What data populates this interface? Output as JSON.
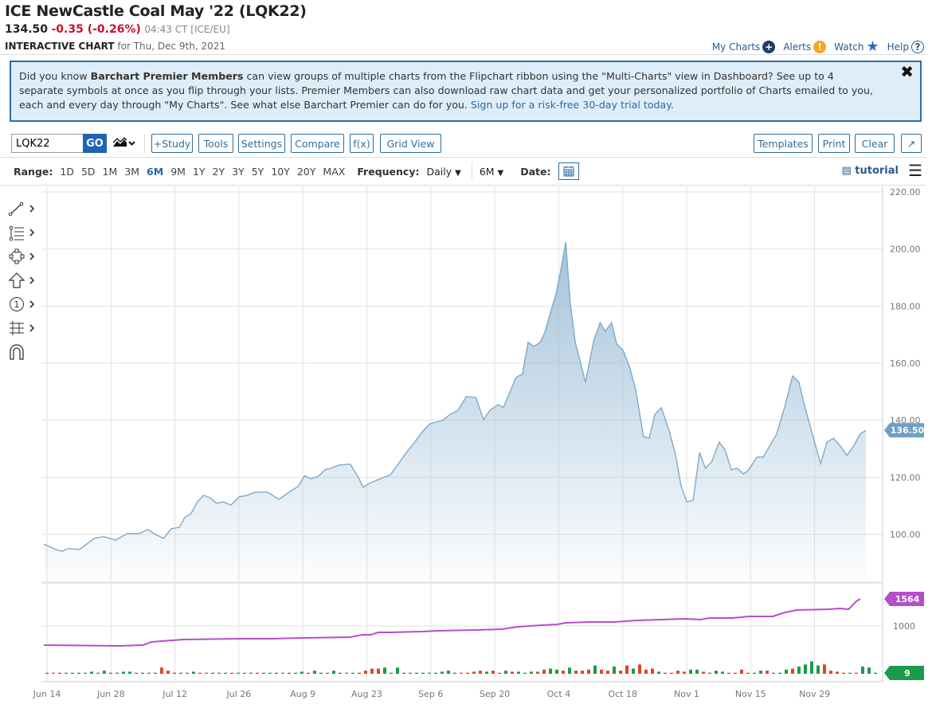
{
  "header": {
    "title": "ICE NewCastle Coal May '22 (LQK22)",
    "last": "134.50",
    "change": "-0.35 (-0.26%)",
    "time": "04:43 CT [ICE/EU]",
    "subtitle_bold": "INTERACTIVE CHART",
    "subtitle_rest": "for Thu, Dec 9th, 2021"
  },
  "top_links": {
    "my_charts": "My Charts",
    "alerts": "Alerts",
    "watch": "Watch",
    "help": "Help"
  },
  "info": {
    "t1": "Did you know ",
    "bold": "Barchart Premier Members",
    "t2": " can view groups of multiple charts from the Flipchart ribbon using the \"Multi-Charts\" view in Dashboard? See up to 4 separate symbols at once as you flip through your lists. Premier Members can also download raw chart data and get your personalized portfolio of Charts emailed to you, each and every day through \"My Charts\". See what else Barchart Premier can do for you. ",
    "link": "Sign up for a risk-free 30-day trial today",
    "t3": ".",
    "close": "✖"
  },
  "toolbar": {
    "symbol": "LQK22",
    "go": "GO",
    "study": "+Study",
    "tools": "Tools",
    "settings": "Settings",
    "compare": "Compare",
    "fx": "f(x)",
    "grid": "Grid View",
    "templates": "Templates",
    "print": "Print",
    "clear": "Clear"
  },
  "range": {
    "label": "Range:",
    "options": [
      "1D",
      "5D",
      "1M",
      "3M",
      "6M",
      "9M",
      "1Y",
      "2Y",
      "3Y",
      "5Y",
      "10Y",
      "20Y",
      "MAX"
    ],
    "selected": "6M",
    "frequency_label": "Frequency:",
    "frequency": "Daily",
    "period": "6M",
    "date_label": "Date:",
    "tutorial": "tutorial"
  },
  "colors": {
    "price_line": "#7fa9c9",
    "price_fill": "#9fc0d8",
    "oi_line": "#b54fc9",
    "up": "#1a9b4b",
    "down": "#e0452c",
    "tag_price": "#6ea0c4"
  },
  "chart_data": {
    "type": "area",
    "x_unit": "trading day index from Jun 14",
    "x_labels": [
      "Jun 14",
      "Jun 28",
      "Jul 12",
      "Jul 26",
      "Aug 9",
      "Aug 23",
      "Sep 6",
      "Sep 20",
      "Oct 4",
      "Oct 18",
      "Nov 1",
      "Nov 15",
      "Nov 29"
    ],
    "y_ticks": [
      "220.00",
      "200.00",
      "180.00",
      "160.00",
      "140.00",
      "120.00",
      "100.00"
    ],
    "ylim": [
      100,
      220
    ],
    "price": [
      [
        -0.5,
        96.6
      ],
      [
        1.4,
        94.7
      ],
      [
        2.4,
        94.1
      ],
      [
        3.3,
        95
      ],
      [
        5.1,
        94.7
      ],
      [
        6.1,
        96.4
      ],
      [
        7.4,
        98.6
      ],
      [
        8.9,
        99.2
      ],
      [
        10.8,
        98
      ],
      [
        12.6,
        100.3
      ],
      [
        14.5,
        100.3
      ],
      [
        15.8,
        101.7
      ],
      [
        17,
        100
      ],
      [
        18.3,
        98.6
      ],
      [
        19.5,
        102
      ],
      [
        20.8,
        102.5
      ],
      [
        21.6,
        105.9
      ],
      [
        22.6,
        107.3
      ],
      [
        23.6,
        111.4
      ],
      [
        24.6,
        113.7
      ],
      [
        25.6,
        112.8
      ],
      [
        26.6,
        110.9
      ],
      [
        27.6,
        111.4
      ],
      [
        28.9,
        110.3
      ],
      [
        30.1,
        113.1
      ],
      [
        31.4,
        113.7
      ],
      [
        32.6,
        114.8
      ],
      [
        34.6,
        114.8
      ],
      [
        36.4,
        112.3
      ],
      [
        37.6,
        114.2
      ],
      [
        39.5,
        117
      ],
      [
        40.4,
        120.6
      ],
      [
        41.4,
        119.5
      ],
      [
        42.6,
        120.4
      ],
      [
        43.6,
        122.6
      ],
      [
        44.5,
        123.2
      ],
      [
        45.8,
        124.3
      ],
      [
        47.6,
        124.6
      ],
      [
        48.9,
        119.8
      ],
      [
        49.6,
        116.5
      ],
      [
        50.8,
        118.1
      ],
      [
        52.6,
        119.8
      ],
      [
        53.9,
        120.9
      ],
      [
        55.1,
        124.6
      ],
      [
        56.4,
        128.7
      ],
      [
        57.6,
        132
      ],
      [
        58.9,
        136
      ],
      [
        60.1,
        138.8
      ],
      [
        62,
        139.9
      ],
      [
        63.3,
        142.1
      ],
      [
        64.5,
        143.5
      ],
      [
        65.8,
        148.3
      ],
      [
        67.3,
        148
      ],
      [
        68.5,
        140.2
      ],
      [
        69.5,
        143.5
      ],
      [
        70.8,
        145.5
      ],
      [
        71.6,
        144.4
      ],
      [
        72.6,
        149.7
      ],
      [
        73.6,
        155
      ],
      [
        74.6,
        156.2
      ],
      [
        75.5,
        167.3
      ],
      [
        76.4,
        165.9
      ],
      [
        77.4,
        167.3
      ],
      [
        78.1,
        170.7
      ],
      [
        79.1,
        178.4
      ],
      [
        79.9,
        184.5
      ],
      [
        80.6,
        192.3
      ],
      [
        81.4,
        202.4
      ],
      [
        82.1,
        181.2
      ],
      [
        82.9,
        167.3
      ],
      [
        83.6,
        161.2
      ],
      [
        84.5,
        153.3
      ],
      [
        85.8,
        167.9
      ],
      [
        86.8,
        174.2
      ],
      [
        87.6,
        171.2
      ],
      [
        88.6,
        174.2
      ],
      [
        89.4,
        166.7
      ],
      [
        90.4,
        164.5
      ],
      [
        91.4,
        158.9
      ],
      [
        92.4,
        150.5
      ],
      [
        93.6,
        134.3
      ],
      [
        94.5,
        133.7
      ],
      [
        95.4,
        142.1
      ],
      [
        96.4,
        144.4
      ],
      [
        97.6,
        136.6
      ],
      [
        98.6,
        128.2
      ],
      [
        99.5,
        117
      ],
      [
        100.4,
        111.4
      ],
      [
        101.4,
        112
      ],
      [
        102.4,
        128.7
      ],
      [
        103.3,
        123.2
      ],
      [
        104.3,
        125.4
      ],
      [
        105.5,
        132.4
      ],
      [
        106.4,
        129.6
      ],
      [
        107.4,
        122.6
      ],
      [
        108.3,
        123.2
      ],
      [
        109.3,
        121.2
      ],
      [
        110.1,
        122.6
      ],
      [
        111.4,
        127.1
      ],
      [
        112.4,
        127.1
      ],
      [
        113.4,
        131
      ],
      [
        114.5,
        135.2
      ],
      [
        115.8,
        145
      ],
      [
        117,
        155.5
      ],
      [
        118,
        153.3
      ],
      [
        118.9,
        144.9
      ],
      [
        120.1,
        135.2
      ],
      [
        121.4,
        124.8
      ],
      [
        122.4,
        132.4
      ],
      [
        123.4,
        133.7
      ],
      [
        124.5,
        131
      ],
      [
        125.5,
        127.7
      ],
      [
        126.6,
        131
      ],
      [
        127.6,
        135.2
      ],
      [
        128.5,
        136.5
      ]
    ],
    "last_price": "136.50",
    "open_interest": {
      "tick": "1000",
      "last": "1564",
      "points": [
        [
          -0.5,
          602
        ],
        [
          11.4,
          585
        ],
        [
          15.1,
          602
        ],
        [
          16.4,
          668
        ],
        [
          21.4,
          718
        ],
        [
          30.1,
          734
        ],
        [
          35.1,
          734
        ],
        [
          40.1,
          751
        ],
        [
          47.6,
          768
        ],
        [
          49.5,
          817
        ],
        [
          50.8,
          817
        ],
        [
          52,
          867
        ],
        [
          53.9,
          867
        ],
        [
          58.9,
          884
        ],
        [
          61.4,
          900
        ],
        [
          67.6,
          917
        ],
        [
          71.4,
          934
        ],
        [
          73.9,
          983
        ],
        [
          77.6,
          1017
        ],
        [
          80.1,
          1033
        ],
        [
          81.4,
          1066
        ],
        [
          85.1,
          1083
        ],
        [
          88.9,
          1083
        ],
        [
          92.6,
          1116
        ],
        [
          96.4,
          1133
        ],
        [
          100.1,
          1149
        ],
        [
          102.6,
          1133
        ],
        [
          103.9,
          1166
        ],
        [
          107.6,
          1166
        ],
        [
          110.1,
          1199
        ],
        [
          113.9,
          1199
        ],
        [
          115.8,
          1282
        ],
        [
          117.6,
          1332
        ],
        [
          122.6,
          1349
        ],
        [
          124.5,
          1365
        ],
        [
          125.8,
          1349
        ],
        [
          127,
          1515
        ],
        [
          127.6,
          1564
        ]
      ]
    },
    "volume": {
      "last": "9",
      "values": [
        1,
        -1,
        -1,
        1,
        1,
        1,
        1,
        2,
        1,
        3,
        -1,
        1,
        2,
        2,
        -1,
        1,
        -1,
        1,
        -6,
        -3,
        -1,
        1,
        -1,
        2,
        -1,
        -1,
        1,
        -1,
        1,
        -1,
        1,
        -1,
        1,
        -1,
        1,
        1,
        1,
        -1,
        -1,
        1,
        2,
        -1,
        3,
        1,
        -1,
        3,
        1,
        -1,
        1,
        -1,
        -3,
        -5,
        -5,
        6,
        1,
        6,
        1,
        1,
        1,
        1,
        1,
        1,
        2,
        3,
        1,
        -1,
        -1,
        -2,
        -3,
        2,
        -3,
        -1,
        3,
        -2,
        2,
        1,
        2,
        -2,
        -4,
        5,
        4,
        -3,
        6,
        -3,
        -3,
        -4,
        8,
        -4,
        -3,
        7,
        -3,
        -8,
        5,
        -9,
        -4,
        -5,
        2,
        -1,
        -1,
        -3,
        -2,
        4,
        4,
        -2,
        1,
        3,
        2,
        -1,
        -1,
        -4,
        -1,
        1,
        3,
        -3,
        1,
        1,
        4,
        -5,
        7,
        9,
        12,
        8,
        -9,
        -3,
        -2,
        -1,
        1,
        -1,
        7,
        6,
        1
      ]
    }
  }
}
